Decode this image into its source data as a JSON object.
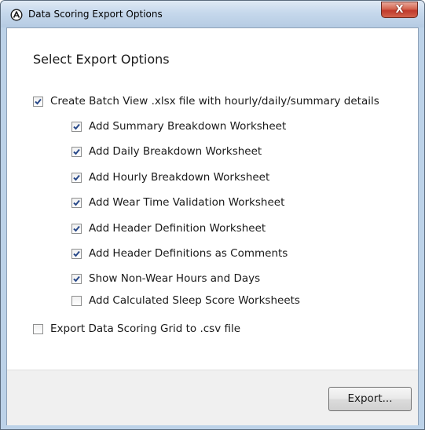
{
  "window": {
    "title": "Data Scoring Export Options",
    "close_label": "X",
    "icon": "actigraph-logo-icon"
  },
  "heading": "Select Export Options",
  "options": [
    {
      "label": "Create Batch View .xlsx file with hourly/daily/summary details",
      "checked": true
    },
    {
      "label": "Add Summary Breakdown Worksheet",
      "checked": true
    },
    {
      "label": "Add Daily Breakdown Worksheet",
      "checked": true
    },
    {
      "label": "Add Hourly Breakdown Worksheet",
      "checked": true
    },
    {
      "label": "Add Wear Time Validation Worksheet",
      "checked": true
    },
    {
      "label": "Add Header Definition Worksheet",
      "checked": true
    },
    {
      "label": "Add Header Definitions as Comments",
      "checked": true
    },
    {
      "label": "Show Non-Wear Hours and Days",
      "checked": true
    },
    {
      "label": "Add Calculated Sleep Score Worksheets",
      "checked": false
    },
    {
      "label": "Export Data Scoring Grid to .csv file",
      "checked": false
    }
  ],
  "footer": {
    "export_label": "Export..."
  },
  "colors": {
    "checkmark": "#2a4a8a",
    "close_button": "#c0392b"
  }
}
